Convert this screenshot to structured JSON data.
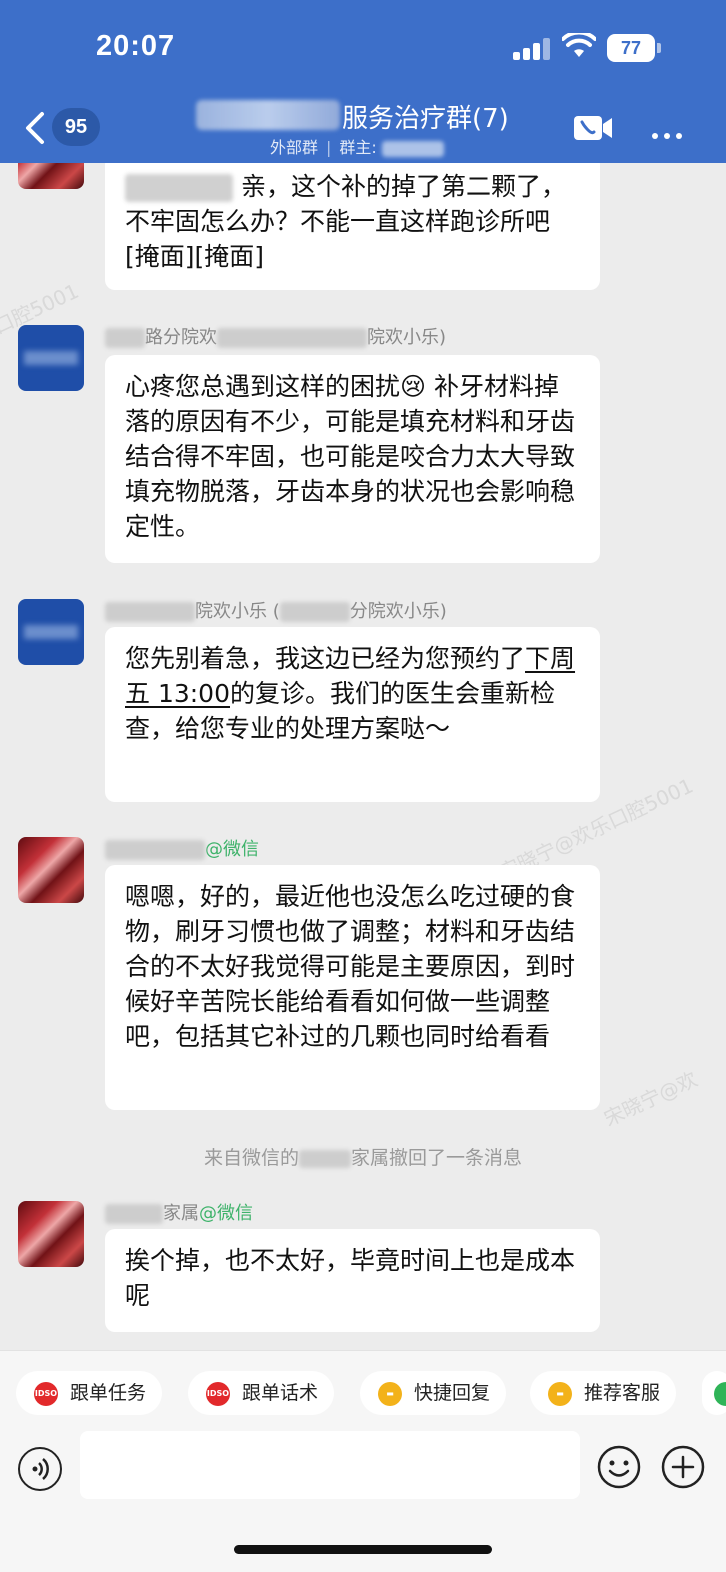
{
  "status_bar": {
    "time": "20:07",
    "battery": "77"
  },
  "header": {
    "back_badge": "95",
    "title": "服务治疗群(7)",
    "subtitle_type": "外部群",
    "subtitle_owner_label": "群主:",
    "accent_color": "#3d6fc9"
  },
  "messages": [
    {
      "sender": "",
      "text_after_blur": " 亲，这个补的掉了第二颗了，不牢固怎么办？不能一直这样跑诊所吧[掩面][掩面]"
    },
    {
      "sender_visible": "路分院欢",
      "sender_tail": "院欢小乐)",
      "text": "心疼您总遇到这样的困扰😢 补牙材料掉落的原因有不少，可能是填充材料和牙齿结合得不牢固，也可能是咬合力太大导致填充物脱落，牙齿本身的状况也会影响稳定性。"
    },
    {
      "sender_visible": "院欢小乐 (",
      "sender_tail": "分院欢小乐)",
      "text_pre": "您先别着急，我这边已经为您预约了",
      "text_underlined": "下周五 13:00",
      "text_post": "的复诊。我们的医生会重新检查，给您专业的处理方案哒～"
    },
    {
      "sender_tail": "@微信",
      "text": "嗯嗯，好的，最近他也没怎么吃过硬的食物，刷牙习惯也做了调整；材料和牙齿结合的不太好我觉得可能是主要原因，到时候好辛苦院长能给看看如何做一些调整吧，包括其它补过的几颗也同时给看看"
    },
    {
      "sender_visible": "家属",
      "sender_tail": "@微信",
      "text": "挨个掉，也不太好，毕竟时间上也是成本呢"
    }
  ],
  "notice": {
    "pre": "来自微信的",
    "post": "家属撤回了一条消息"
  },
  "quick_actions": [
    {
      "label": "跟单任务",
      "icon": "idso-red-icon"
    },
    {
      "label": "跟单话术",
      "icon": "idso-red-icon"
    },
    {
      "label": "快捷回复",
      "icon": "chat-yellow-icon"
    },
    {
      "label": "推荐客服",
      "icon": "chat-yellow-icon"
    }
  ],
  "icon_text": "IDSO",
  "watermarks": [
    "口腔5001",
    "宋晓宁@欢乐口腔5001",
    "宋晓宁@欢"
  ]
}
